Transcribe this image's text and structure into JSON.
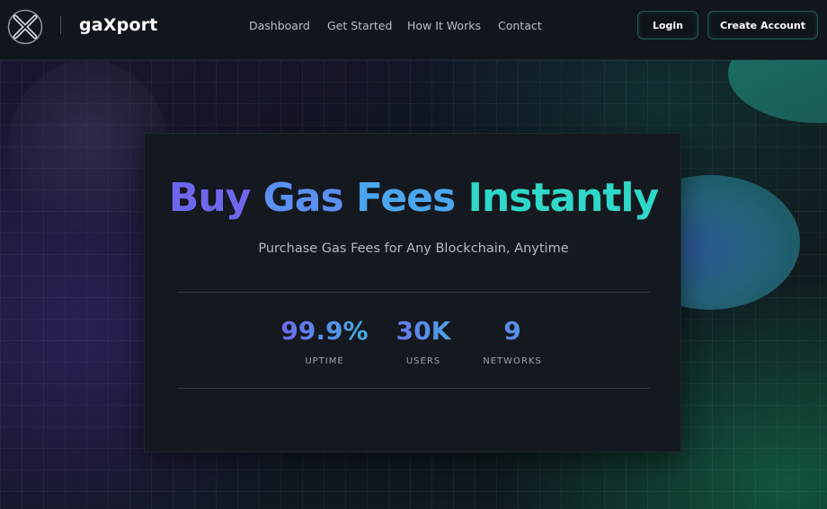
{
  "brand": {
    "name": "gaXport",
    "logo_icon": "x-logo-icon"
  },
  "nav": {
    "links": [
      "Dashboard",
      "Get Started",
      "How It Works",
      "Contact"
    ]
  },
  "auth": {
    "login_label": "Login",
    "create_account_label": "Create Account"
  },
  "hero": {
    "title_words": [
      {
        "text": "Buy",
        "color": "#6f66ee"
      },
      {
        "text": "Gas",
        "color": "#5b8ff0"
      },
      {
        "text": "Fees",
        "color": "#4aa6ee"
      },
      {
        "text": "Instantly",
        "color": "#2fd8c8"
      }
    ],
    "subtitle": "Purchase Gas Fees for Any Blockchain, Anytime"
  },
  "stats": [
    {
      "value": "99.9%",
      "label": "UPTIME"
    },
    {
      "value": "30K",
      "label": "USERS"
    },
    {
      "value": "9",
      "label": "NETWORKS"
    }
  ],
  "colors": {
    "accent_purple": "#6f66ee",
    "accent_teal": "#2fd8c8",
    "background": "#0c1016",
    "card": "#14181f"
  }
}
